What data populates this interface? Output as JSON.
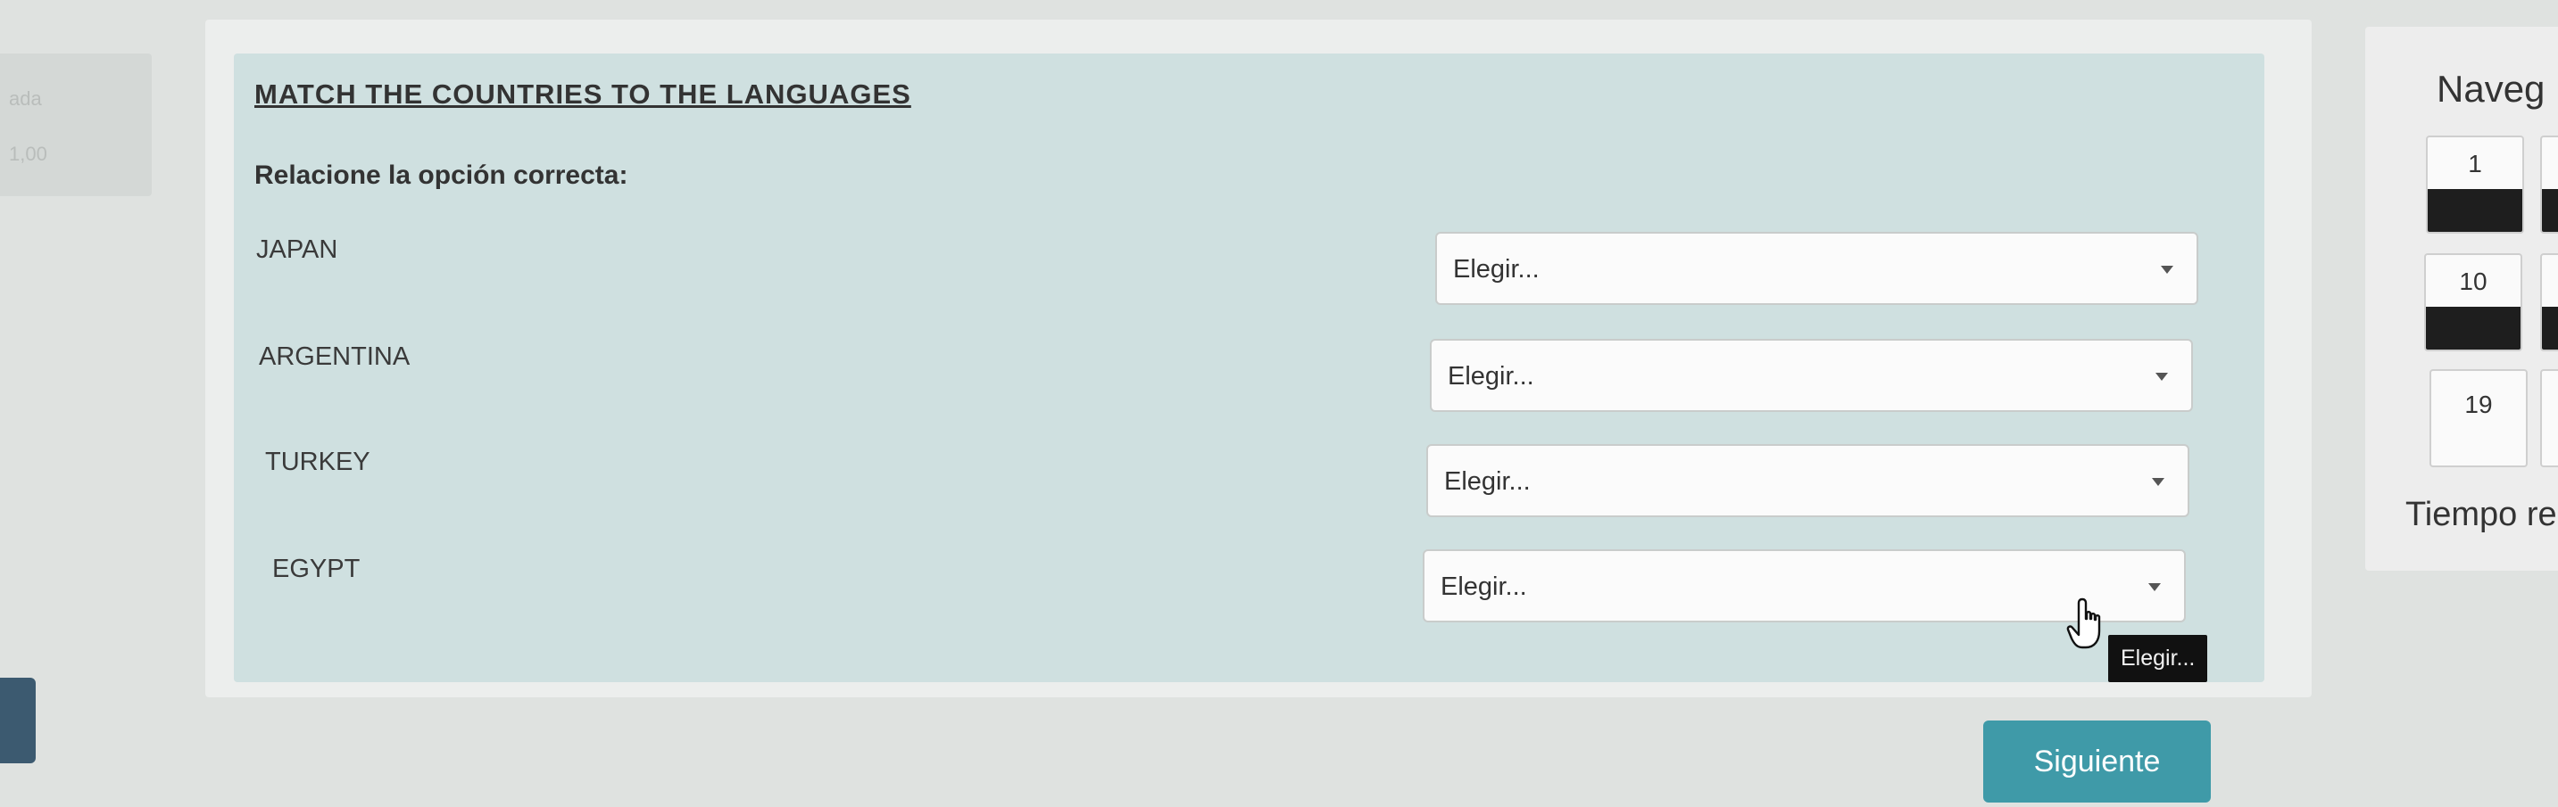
{
  "left_info": {
    "line1": "ada",
    "line2": "1,00"
  },
  "question": {
    "title": "MATCH THE COUNTRIES TO THE LANGUAGES",
    "instruction": "Relacione la opción correcta:",
    "rows": [
      {
        "label": "JAPAN",
        "selected": "Elegir..."
      },
      {
        "label": "ARGENTINA",
        "selected": "Elegir..."
      },
      {
        "label": "TURKEY",
        "selected": "Elegir..."
      },
      {
        "label": "EGYPT",
        "selected": "Elegir..."
      }
    ],
    "tooltip": "Elegir..."
  },
  "next_button": "Siguiente",
  "navigation": {
    "title": "Naveg",
    "buttons": [
      "1",
      "10",
      "19"
    ],
    "time_label": "Tiempo re"
  },
  "colors": {
    "panel_bg": "#cfe0e0",
    "next_button": "#3f9aa8",
    "nav_state_answered": "#1e1e1e"
  }
}
